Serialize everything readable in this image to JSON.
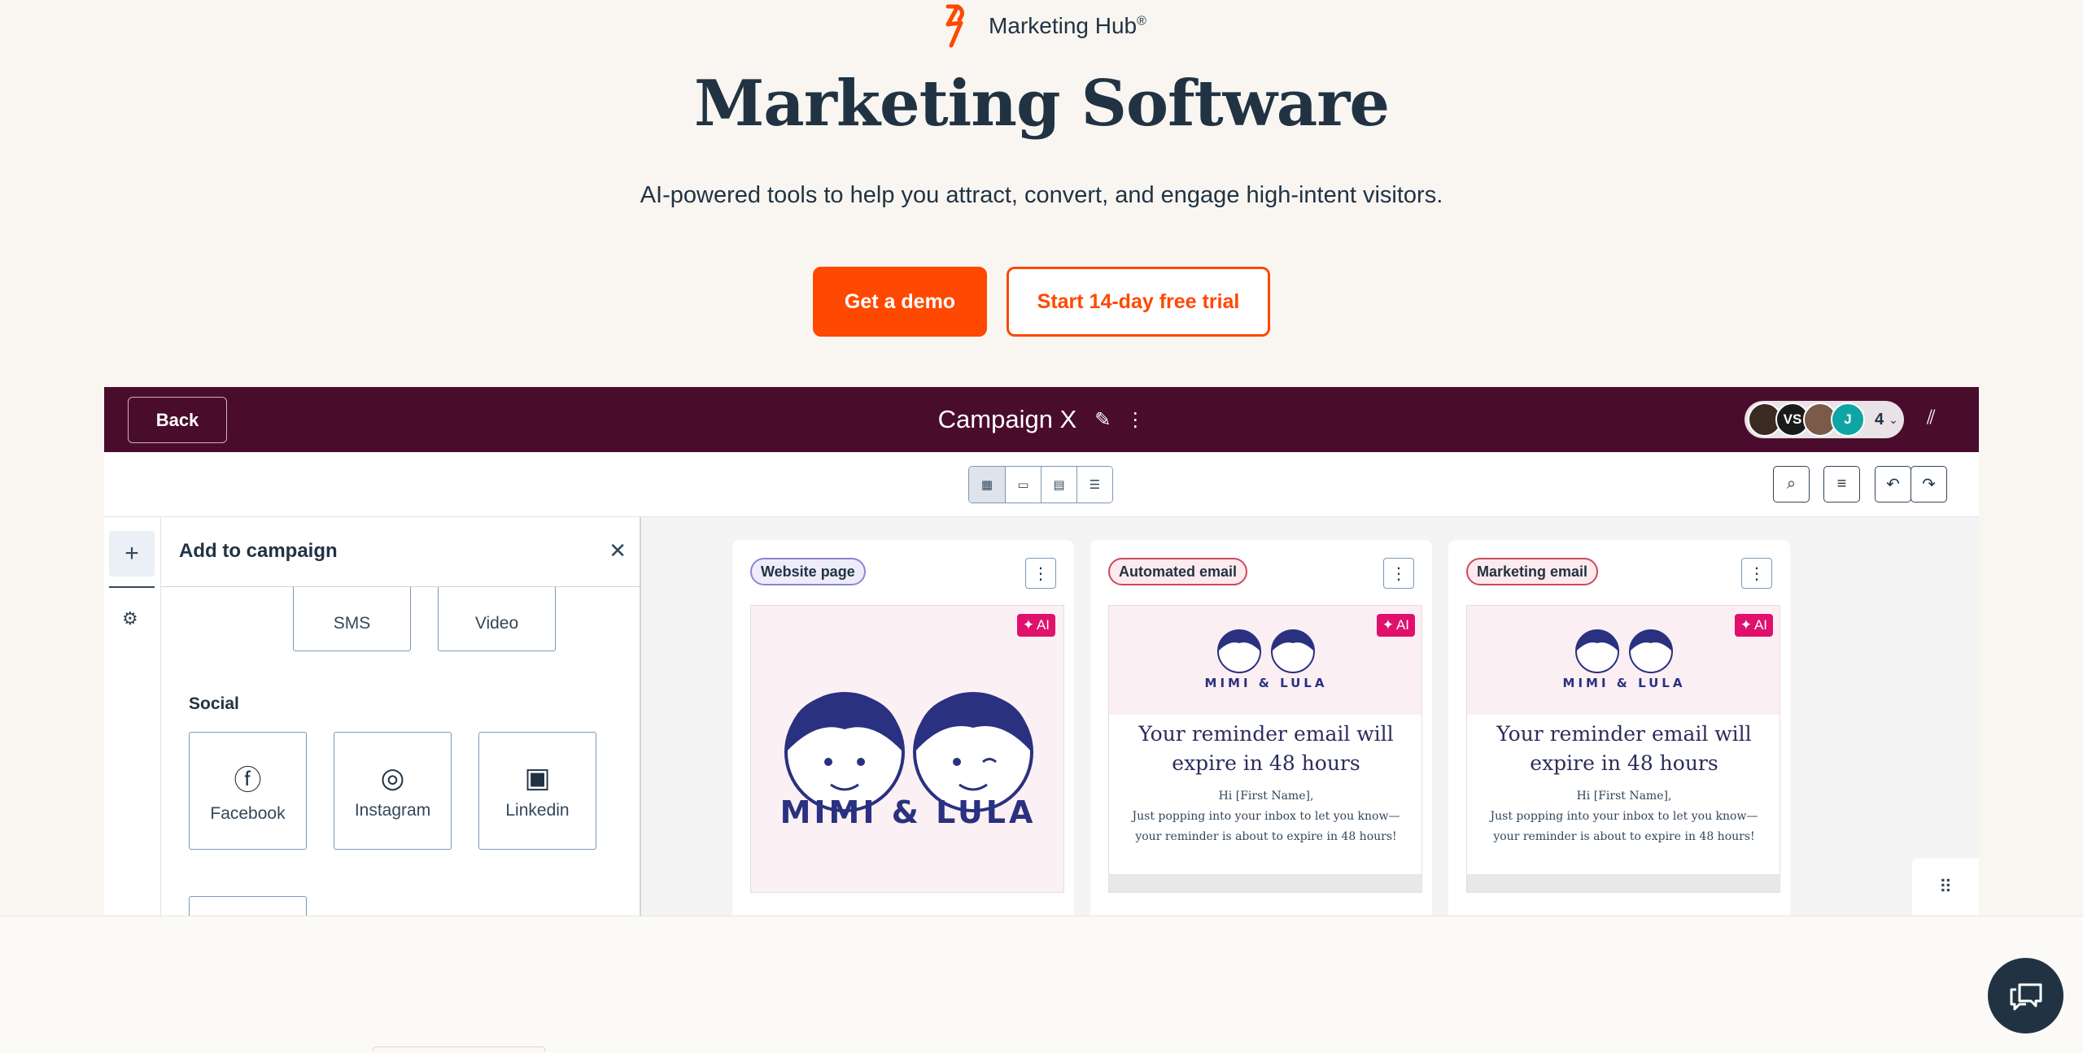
{
  "brand": {
    "name": "Marketing Hub",
    "reg": "®"
  },
  "hero": {
    "title": "Marketing Software",
    "subtitle": "AI-powered tools to help you attract, convert, and engage high-intent visitors.",
    "primary_cta": "Get a demo",
    "secondary_cta": "Start 14-day free trial"
  },
  "app": {
    "back_label": "Back",
    "campaign_title": "Campaign X",
    "avatars": [
      "",
      "VS",
      "",
      "J"
    ],
    "avatar_count": "4",
    "toolbar": {
      "views": [
        "grid-view-icon",
        "calendar-view-icon",
        "table-view-icon",
        "list-view-icon"
      ]
    },
    "panel": {
      "title": "Add to campaign",
      "tiles_top": [
        "SMS",
        "Video"
      ],
      "social_label": "Social",
      "social_tiles": [
        "Facebook",
        "Instagram",
        "Linkedin"
      ]
    },
    "cards": [
      {
        "badge": "Website page",
        "ai": "AI",
        "logo": "MIMI & LULA"
      },
      {
        "badge": "Automated email",
        "ai": "AI",
        "logo": "MIMI & LULA",
        "heading": "Your reminder email will expire in 48 hours",
        "greeting": "Hi [First Name],",
        "body": "Just popping into your inbox to let you know—your reminder is about to expire in 48 hours!"
      },
      {
        "badge": "Marketing email",
        "ai": "AI",
        "logo": "MIMI & LULA",
        "heading": "Your reminder email will expire in 48 hours",
        "greeting": "Hi [First Name],",
        "body": "Just popping into your inbox to let you know—your reminder is about to expire in 48 hours!"
      }
    ]
  },
  "colors": {
    "accent": "#ff4800",
    "header": "#4a0c2d",
    "ai": "#e0106d",
    "navy": "#213343"
  }
}
